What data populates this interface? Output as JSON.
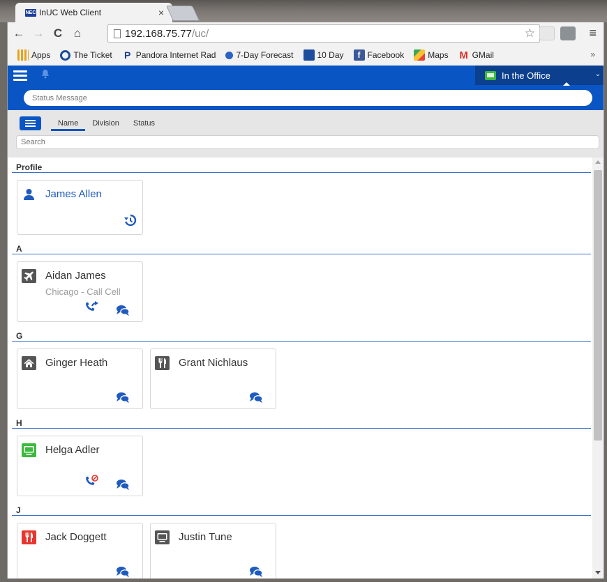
{
  "browser": {
    "tab_title": "InUC Web Client",
    "tab_favicon_text": "NEC",
    "close_glyph": "×",
    "url_host": "192.168.75.77",
    "url_path": "/uc/",
    "nav": {
      "back": "←",
      "forward": "→",
      "reload": "C",
      "home": "⌂",
      "star": "☆",
      "menu": "≡"
    },
    "bookmarks": [
      {
        "label": "Apps",
        "icon": "apps-grid-icon"
      },
      {
        "label": "The Ticket",
        "icon": "the-ticket-icon"
      },
      {
        "label": "Pandora Internet Rad",
        "icon": "pandora-icon",
        "glyph": "P"
      },
      {
        "label": "7-Day Forecast",
        "icon": "noaa-icon"
      },
      {
        "label": "10 Day",
        "icon": "weather-channel-icon"
      },
      {
        "label": "Facebook",
        "icon": "facebook-icon",
        "glyph": "f"
      },
      {
        "label": "Maps",
        "icon": "maps-icon"
      },
      {
        "label": "GMail",
        "icon": "gmail-icon",
        "glyph": "M"
      }
    ],
    "bookmarks_more": "»"
  },
  "app": {
    "presence_label": "In the Office",
    "presence_caret": "⌄",
    "status_placeholder": "Status Message",
    "sort_tabs": [
      "Name",
      "Division",
      "Status"
    ],
    "active_sort": "Name",
    "search_placeholder": "Search",
    "colors": {
      "brand_blue": "#0a55c4",
      "presence_dark": "#0c3f8e",
      "available_green": "#3db93d",
      "busy_red": "#e8352f",
      "neutral_gray": "#555555",
      "contact_name_blue": "#1f5bbf"
    }
  },
  "sections": [
    {
      "header": "Profile",
      "cards": [
        {
          "name": "James Allen",
          "status_icon": "person-icon",
          "actions": [
            "history-icon"
          ]
        }
      ]
    },
    {
      "header": "A",
      "cards": [
        {
          "name": "Aidan James",
          "subtitle": "Chicago - Call Cell",
          "status_icon": "airplane-icon",
          "actions": [
            "call-forward-icon",
            "chat-icon"
          ]
        }
      ]
    },
    {
      "header": "G",
      "cards": [
        {
          "name": "Ginger Heath",
          "status_icon": "home-icon",
          "actions": [
            "chat-icon"
          ]
        },
        {
          "name": "Grant Nichlaus",
          "status_icon": "fork-knife-icon",
          "actions": [
            "chat-icon"
          ]
        }
      ]
    },
    {
      "header": "H",
      "cards": [
        {
          "name": "Helga Adler",
          "status_icon": "monitor-icon",
          "actions": [
            "call-blocked-icon",
            "chat-icon"
          ]
        }
      ]
    },
    {
      "header": "J",
      "cards": [
        {
          "name": "Jack Doggett",
          "status_icon": "fork-knife-icon",
          "actions": [
            "chat-icon"
          ]
        },
        {
          "name": "Justin Tune",
          "status_icon": "monitor-icon",
          "actions": [
            "chat-icon"
          ]
        }
      ]
    }
  ]
}
